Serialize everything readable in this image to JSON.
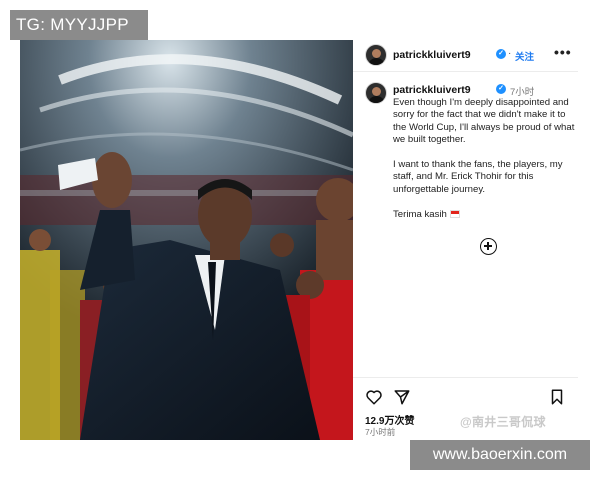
{
  "watermarks": {
    "top_left": "TG: MYYJJPP",
    "bottom_right": "www.baoerxin.com",
    "source": "@南井三哥侃球"
  },
  "post": {
    "username": "patrickkluivert9",
    "follow_label": "关注",
    "more_label": "•••",
    "verified_mark": "✓",
    "caption_username": "patrickkluivert9",
    "time_ago": "7小时",
    "caption": {
      "paragraph_1": "Even though I'm deeply disappointed and sorry for the fact that we didn't make it to the World Cup, I'll always be proud of what we built together.",
      "paragraph_2": "I want to thank the fans, the players, my staff, and Mr. Erick Thohir for this unforgettable journey.",
      "paragraph_3": "Terima kasih"
    },
    "likes": "12.9万次赞",
    "post_time": "7小时前"
  },
  "icons": {
    "verified": "verified-badge-icon",
    "add_comment": "plus-circle-icon",
    "like": "heart-icon",
    "share": "send-icon",
    "save": "bookmark-icon",
    "flag": "indonesia-flag-icon"
  },
  "colors": {
    "verified_blue": "#1e90ff",
    "follow_blue": "#1e7bf0",
    "banner_gray": "#8b8b8b",
    "jersey_red": "#c4161c"
  }
}
